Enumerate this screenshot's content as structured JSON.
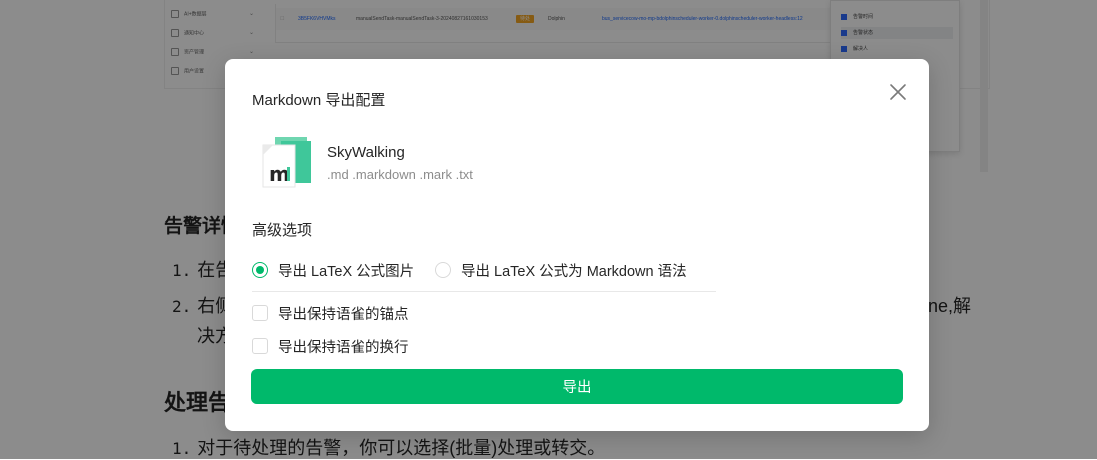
{
  "background": {
    "screenshot": {
      "nav_items": [
        {
          "label": "AI+数据层",
          "icon": "grid-icon"
        },
        {
          "label": "通知中心",
          "icon": "bell-icon"
        },
        {
          "label": "资产管理",
          "icon": "asset-icon"
        },
        {
          "label": "用户设置",
          "icon": "user-icon"
        }
      ],
      "table_row": {
        "id": "3B5FK6VHVMks",
        "name": "manualSendTask-manualSendTask-3-20240827161030153",
        "status": "待处",
        "source": "Dolphin",
        "target": "bus_servicecow-mo-mp-bdolphinscheduler-worker-0.dolphinscheduler-worker-headless:12"
      },
      "panel_items": [
        "告警时间",
        "告警状态",
        "解决人"
      ]
    },
    "doc": {
      "heading_1": "告警详情",
      "list_1": [
        {
          "num": "1.",
          "text": "在告"
        },
        {
          "num": "2.",
          "text": "右侧",
          "continuation": "决方"
        }
      ],
      "list_1_tail": "ne,解",
      "heading_2": "处理告",
      "list_2": [
        {
          "num": "1.",
          "text": "对于待处理的告警，你可以选择(批量)处理或转交。"
        }
      ]
    }
  },
  "modal": {
    "title": "Markdown 导出配置",
    "close_icon": "close-icon",
    "app": {
      "name": "SkyWalking",
      "extensions": ".md .markdown .mark .txt",
      "icon": "markdown-file-icon",
      "icon_letter": "m"
    },
    "advanced_title": "高级选项",
    "radios": [
      {
        "label": "导出 LaTeX 公式图片",
        "checked": true
      },
      {
        "label": "导出 LaTeX 公式为 Markdown 语法",
        "checked": false
      }
    ],
    "checkboxes": [
      {
        "label": "导出保持语雀的锚点",
        "checked": false
      },
      {
        "label": "导出保持语雀的换行",
        "checked": false
      }
    ],
    "export_label": "导出"
  },
  "colors": {
    "accent": "#00b96b",
    "overlay": "rgba(0,0,0,0.45)"
  }
}
